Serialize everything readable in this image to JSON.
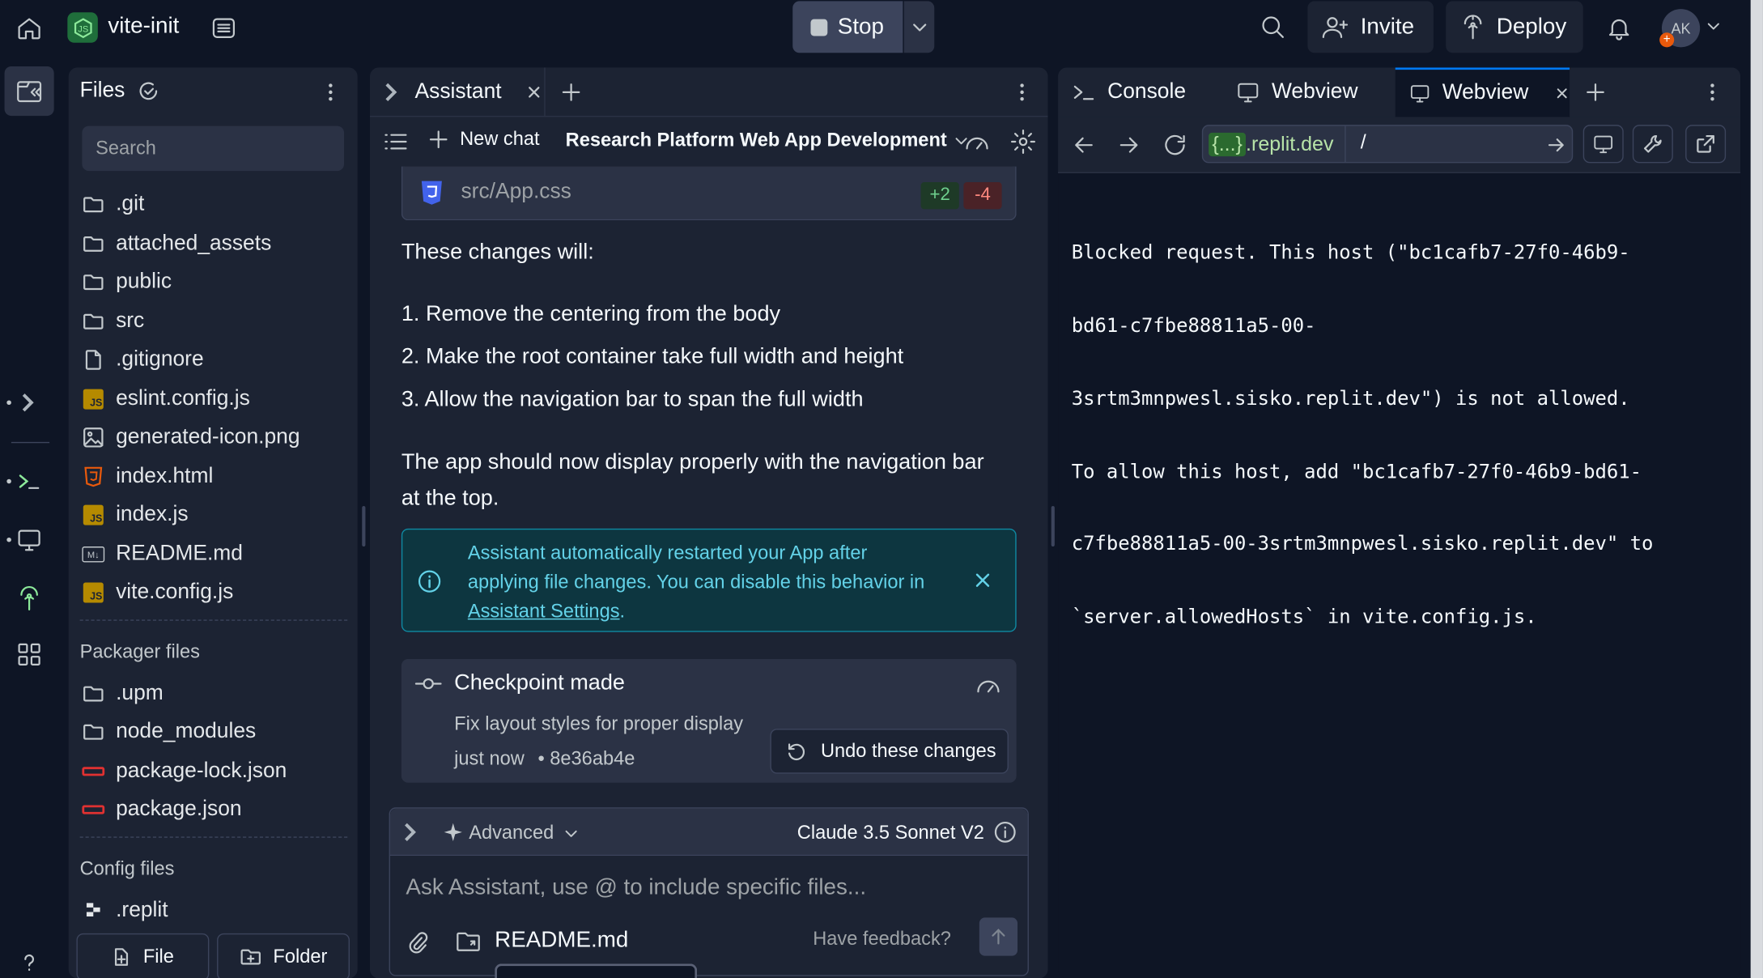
{
  "topbar": {
    "repl_name": "vite-init",
    "stop_label": "Stop",
    "invite_label": "Invite",
    "deploy_label": "Deploy",
    "avatar_initials": "AK"
  },
  "files": {
    "title": "Files",
    "search_placeholder": "Search",
    "items": [
      {
        "name": ".git",
        "icon": "folder-icon"
      },
      {
        "name": "attached_assets",
        "icon": "folder-icon"
      },
      {
        "name": "public",
        "icon": "folder-icon"
      },
      {
        "name": "src",
        "icon": "folder-icon"
      },
      {
        "name": ".gitignore",
        "icon": "file-icon"
      },
      {
        "name": "eslint.config.js",
        "icon": "js-file-icon"
      },
      {
        "name": "generated-icon.png",
        "icon": "image-file-icon"
      },
      {
        "name": "index.html",
        "icon": "html-file-icon"
      },
      {
        "name": "index.js",
        "icon": "js-file-icon"
      },
      {
        "name": "README.md",
        "icon": "markdown-file-icon"
      },
      {
        "name": "vite.config.js",
        "icon": "js-file-icon"
      }
    ],
    "packager_title": "Packager files",
    "packager_items": [
      {
        "name": ".upm",
        "icon": "folder-icon"
      },
      {
        "name": "node_modules",
        "icon": "folder-icon"
      },
      {
        "name": "package-lock.json",
        "icon": "json-file-icon"
      },
      {
        "name": "package.json",
        "icon": "json-file-icon"
      }
    ],
    "config_title": "Config files",
    "config_items": [
      {
        "name": ".replit",
        "icon": "replit-file-icon"
      }
    ],
    "new_file_label": "File",
    "new_folder_label": "Folder"
  },
  "assistant": {
    "tab_label": "Assistant",
    "new_chat_label": "New chat",
    "chat_title": "Research Platform Web App Development",
    "file_change": {
      "name": "src/App.css",
      "added": "+2",
      "removed": "-4"
    },
    "intro": "These changes will:",
    "steps": [
      "1. Remove the centering from the body",
      "2. Make the root container take full width and height",
      "3. Allow the navigation bar to span the full width"
    ],
    "summary_line1": "The app should now display properly with the navigation bar",
    "summary_line2": "at the top.",
    "banner": {
      "line1": "Assistant automatically restarted your App after",
      "line2": "applying file changes. You can disable this behavior in",
      "link": "Assistant Settings",
      "period": "."
    },
    "checkpoint": {
      "title": "Checkpoint made",
      "description": "Fix layout styles for proper display",
      "time": "just now",
      "commit": "• 8e36ab4e",
      "undo_label": "Undo these changes"
    },
    "composer": {
      "mode_label": "Advanced",
      "model_label": "Claude 3.5 Sonnet V2",
      "placeholder": "Ask Assistant, use @ to include specific files...",
      "attached_file": "README.md",
      "feedback_label": "Have feedback?"
    }
  },
  "right": {
    "tabs": [
      {
        "label": "Console"
      },
      {
        "label": "Webview"
      },
      {
        "label": "Webview"
      }
    ],
    "url_brace": "{...}",
    "url_domain": ".replit.dev",
    "url_path": "/",
    "console_lines": [
      "Blocked request. This host (\"bc1cafb7-27f0-46b9-",
      "bd61-c7fbe88811a5-00-",
      "3srtm3mnpwesl.sisko.replit.dev\") is not allowed.",
      "To allow this host, add \"bc1cafb7-27f0-46b9-bd61-",
      "c7fbe88811a5-00-3srtm3mnpwesl.sisko.replit.dev\" to",
      "`server.allowedHosts` in vite.config.js."
    ]
  },
  "colors": {
    "background": "#0e1525",
    "surface": "#1c2333",
    "accent_blue": "#0079f2",
    "info_cyan": "#63d2e8",
    "added_green": "#6fd08e",
    "removed_red": "#ff8a80"
  }
}
